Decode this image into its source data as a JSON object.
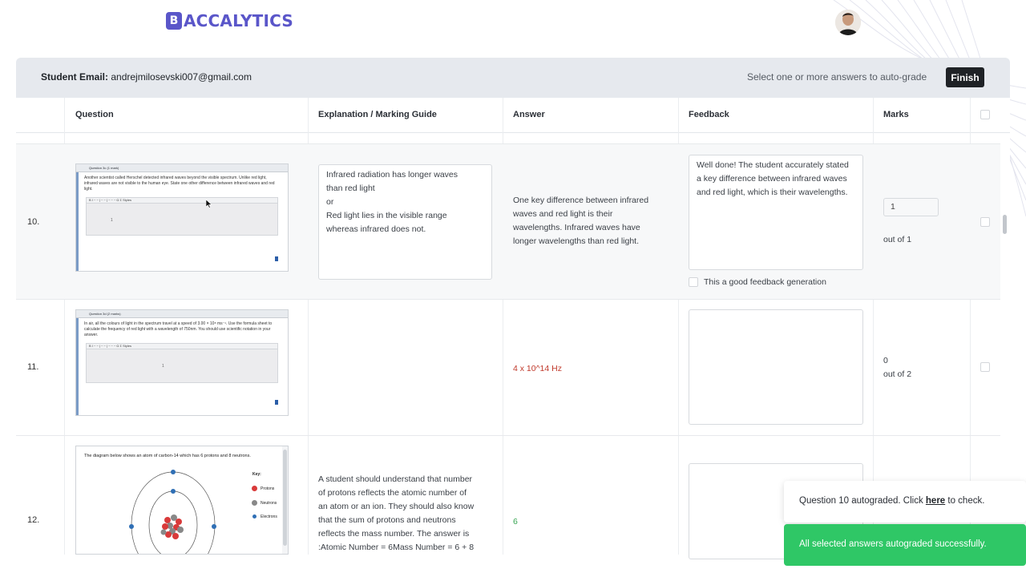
{
  "header": {
    "logo_letter": "B",
    "logo_text": "ACCALYTICS"
  },
  "toolbar": {
    "email_label": "Student Email:",
    "email_value": "andrejmilosevski007@gmail.com",
    "select_hint": "Select one or more answers to auto-grade",
    "finish_label": "Finish"
  },
  "table": {
    "columns": [
      "Question",
      "Explanation / Marking Guide",
      "Answer",
      "Feedback",
      "Marks"
    ],
    "rows": [
      {
        "number": "10.",
        "question_image": {
          "title": "Question 3c (1 mark)",
          "text": "Another scientist called Herschel detected infrared waves beyond the visible spectrum. Unlike red light, infrared waves are not visible to the human eye. State one other difference between infrared waves and red light.",
          "toolbar": "B I ~ ~ | ~ ~ | ~ ~ ~ Ω Σ Styles",
          "editor_value": "1"
        },
        "explanation_lines": [
          "Infrared radiation has longer waves",
          "than red light",
          "or",
          "Red light lies in the visible range",
          "whereas infrared does not."
        ],
        "answer": "One key difference between infrared waves and red light is their wavelengths. Infrared waves have longer wavelengths than red light.",
        "feedback": "Well done! The student accurately stated a key difference between infrared waves and red light, which is their wavelengths.",
        "good_feedback_label": "This a good feedback generation",
        "marks_value": "1",
        "marks_out_of": "out of 1"
      },
      {
        "number": "11.",
        "question_image": {
          "title": "Question 3d (2 marks)",
          "text": "In air, all the colours of light in the spectrum travel at a speed of 3.00 × 10⁸ ms⁻¹. Use the formula sheet to calculate the frequency of red light with a wavelength of 750nm. You should use scientific notation in your answer.",
          "toolbar": "B I ~ ~ | ~ ~ | ~ ~ ~ Ω Σ Styles",
          "editor_value": "1"
        },
        "answer": "4 x 10^14 Hz",
        "answer_color": "#c0392b",
        "marks_value": "0",
        "marks_out_of": "out of 2"
      },
      {
        "number": "12.",
        "question_image": {
          "text": "The diagram below shows an atom of carbon-14 which has 6 protons and 8 neutrons.",
          "key_title": "Key:",
          "key_items": [
            "Protons",
            "Neutrons",
            "Electrons"
          ]
        },
        "explanation_lines": [
          "A student should understand that number",
          "of protons reflects the atomic number of",
          "an atom or an ion. They should also know",
          "that the sum of protons and neutrons",
          "reflects the mass number. The answer is",
          ":Atomic Number = 6Mass Number = 6 + 8"
        ],
        "answer": "6",
        "answer_color": "#3aa655"
      }
    ]
  },
  "toasts": {
    "info_prefix": "Question 10 autograded. Click ",
    "info_link": "here",
    "info_suffix": " to check.",
    "success": "All selected answers autograded successfully."
  },
  "colors": {
    "brand": "#5a56c9",
    "success": "#2fc766",
    "dark_button": "#1f2226"
  }
}
